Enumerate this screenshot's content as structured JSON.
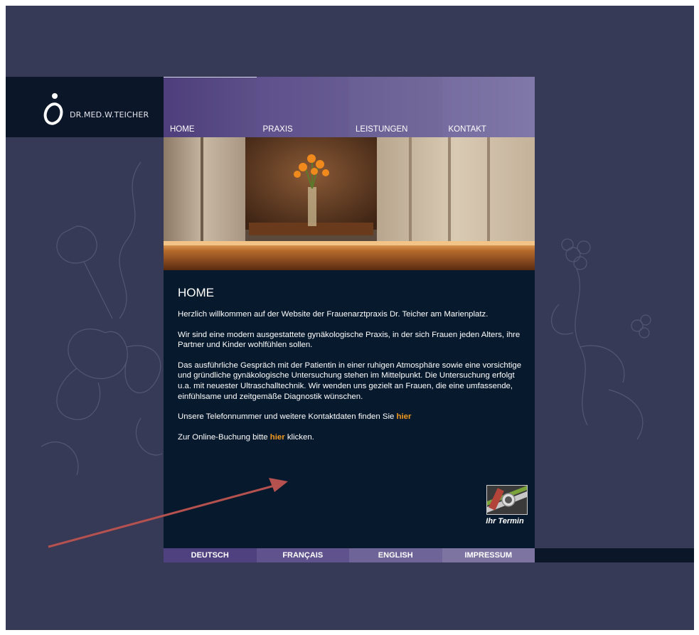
{
  "brand": {
    "logo_text": "DR.MED.W.TEICHER"
  },
  "nav": {
    "tabs": [
      {
        "label": "HOME",
        "color": "#5a4c84",
        "active": true
      },
      {
        "label": "PRAXIS",
        "color": "#64588e"
      },
      {
        "label": "LEISTUNGEN",
        "color": "#716796"
      },
      {
        "label": "KONTAKT",
        "color": "#7c73a0"
      }
    ]
  },
  "content": {
    "heading": "HOME",
    "p1": "Herzlich willkommen auf der Website der Frauenarztpraxis Dr. Teicher am Marienplatz.",
    "p2": "Wir sind eine modern ausgestattete gynäkologische Praxis, in der sich Frauen jeden Alters, ihre Partner und Kinder wohlfühlen sollen.",
    "p3": "Das ausführliche Gespräch mit der Patientin in einer ruhigen Atmosphäre sowie eine vorsichtige und gründliche gynäkologische Untersuchung stehen im Mittelpunkt.  Die Untersuchung erfolgt u.a. mit neuester Ultraschalltechnik. Wir wenden uns gezielt an Frauen, die eine umfassende, einfühlsame und zeitgemäße Diagnostik wünschen.",
    "p4_text": "Unsere Telefonnummer und weitere Kontaktdaten finden Sie ",
    "p4_link": "hier",
    "p5_text_before": "Zur Online-Buchung bitte ",
    "p5_link": "hier",
    "p5_text_after": " klicken.",
    "termin_label": "Ihr Termin"
  },
  "footer": {
    "langs": [
      {
        "label": "DEUTSCH",
        "color": "#5a4c84"
      },
      {
        "label": "FRANÇAIS",
        "color": "#64588e"
      },
      {
        "label": "ENGLISH",
        "color": "#716796"
      },
      {
        "label": "IMPRESSUM",
        "color": "#7c73a0"
      }
    ]
  },
  "colors": {
    "page_bg": "#363a56",
    "content_bg": "#07192c",
    "link": "#f29a1d",
    "arrow": "#b5514f"
  }
}
